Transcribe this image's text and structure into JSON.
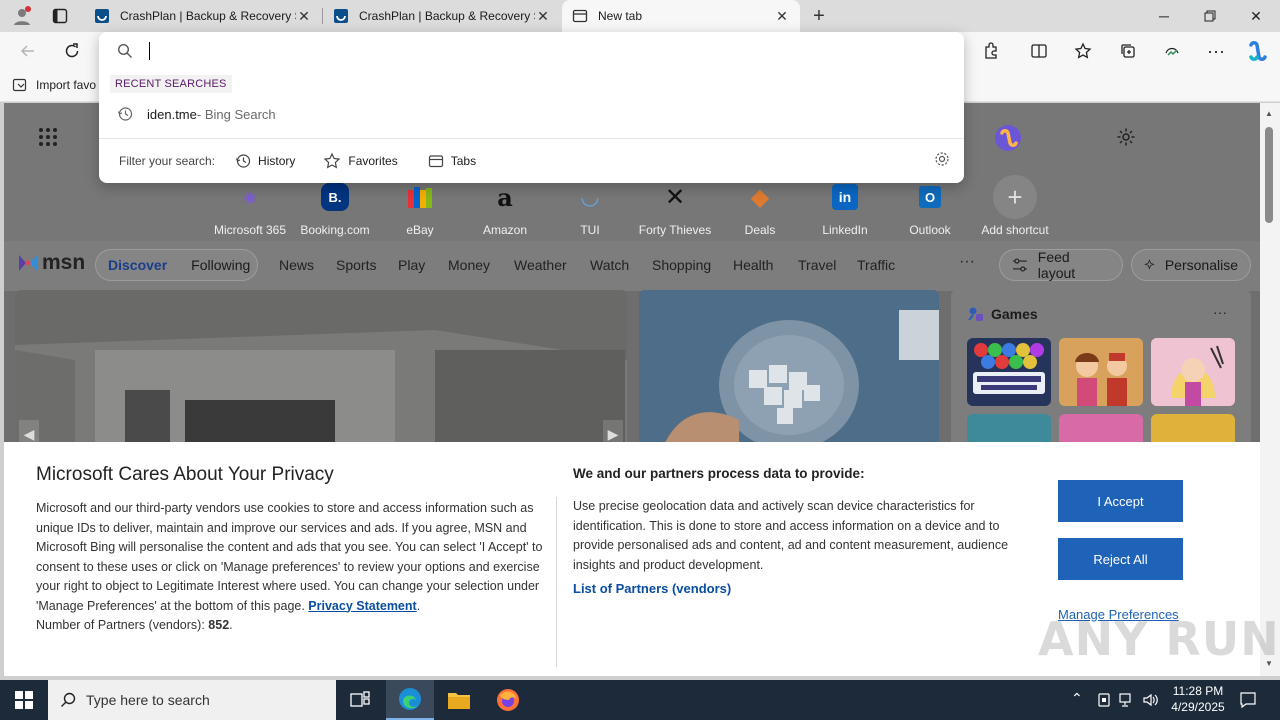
{
  "tabs": [
    {
      "title": "CrashPlan | Backup & Recovery S",
      "active": false
    },
    {
      "title": "CrashPlan | Backup & Recovery S",
      "active": false
    },
    {
      "title": "New tab",
      "active": true
    }
  ],
  "favorites_bar": {
    "import_label": "Import favo"
  },
  "omnibox": {
    "value": "",
    "recent_label": "RECENT SEARCHES",
    "suggestion_query": "iden.tme",
    "suggestion_source": " - Bing Search",
    "filter_label": "Filter your search:",
    "filters": [
      "History",
      "Favorites",
      "Tabs"
    ]
  },
  "shortcuts": [
    {
      "label": "Microsoft 365",
      "icon": "m365-icon",
      "color": "#7b5cd6",
      "glyph": "◉"
    },
    {
      "label": "Booking.com",
      "icon": "booking-icon",
      "color": "#003580",
      "glyph": "B."
    },
    {
      "label": "eBay",
      "icon": "ebay-icon",
      "color": "#e53238",
      "glyph": "▮"
    },
    {
      "label": "Amazon",
      "icon": "amazon-icon",
      "color": "#ffffff",
      "glyph": "a"
    },
    {
      "label": "TUI",
      "icon": "tui-icon",
      "color": "#5fa8e6",
      "glyph": "◡"
    },
    {
      "label": "Forty Thieves",
      "icon": "forty-thieves-icon",
      "color": "#ffffff",
      "glyph": "✕"
    },
    {
      "label": "Deals",
      "icon": "deals-icon",
      "color": "#e07a2f",
      "glyph": "◆"
    },
    {
      "label": "LinkedIn",
      "icon": "linkedin-icon",
      "color": "#0a66c2",
      "glyph": "in"
    },
    {
      "label": "Outlook",
      "icon": "outlook-icon",
      "color": "#0f6cbd",
      "glyph": "O"
    },
    {
      "label": "Add shortcut",
      "icon": "plus-icon",
      "color": "#8a8a8a",
      "glyph": "+"
    }
  ],
  "msn": {
    "logo": "msn",
    "discover": "Discover",
    "following": "Following",
    "nav": [
      "News",
      "Sports",
      "Play",
      "Money",
      "Weather",
      "Watch",
      "Shopping",
      "Health",
      "Travel",
      "Traffic"
    ],
    "more": "···",
    "feed_layout": "Feed layout",
    "personalise": "Personalise",
    "games_title": "Games",
    "games_more": "···"
  },
  "privacy": {
    "title": "Microsoft Cares About Your Privacy",
    "body": "Microsoft and our third-party vendors use cookies to store and access information such as unique IDs to deliver, maintain and improve our services and ads. If you agree, MSN and Microsoft Bing will personalise the content and ads that you see. You can select 'I Accept' to consent to these uses or click on 'Manage preferences' to review your options and exercise your right to object to Legitimate Interest where used.  You can change your selection under 'Manage Preferences' at the bottom of this page. ",
    "privacy_link": "Privacy Statement",
    "partners_label": "Number of Partners (vendors): ",
    "partners_count": "852",
    "right_title": "We and our partners process data to provide:",
    "right_body": "Use precise geolocation data and actively scan device characteristics for identification. This is done to store and access information on a device and to provide personalised ads and content, ad and content measurement, audience insights and product development.",
    "vendors_link": "List of Partners (vendors)",
    "accept": "I Accept",
    "reject": "Reject All",
    "manage": "Manage Preferences"
  },
  "watermark": "ANY RUN",
  "taskbar": {
    "search_placeholder": "Type here to search",
    "time": "11:28 PM",
    "date": "4/29/2025"
  },
  "colors": {
    "accent": "#1e63b7",
    "taskbar": "#1c2a3a"
  }
}
